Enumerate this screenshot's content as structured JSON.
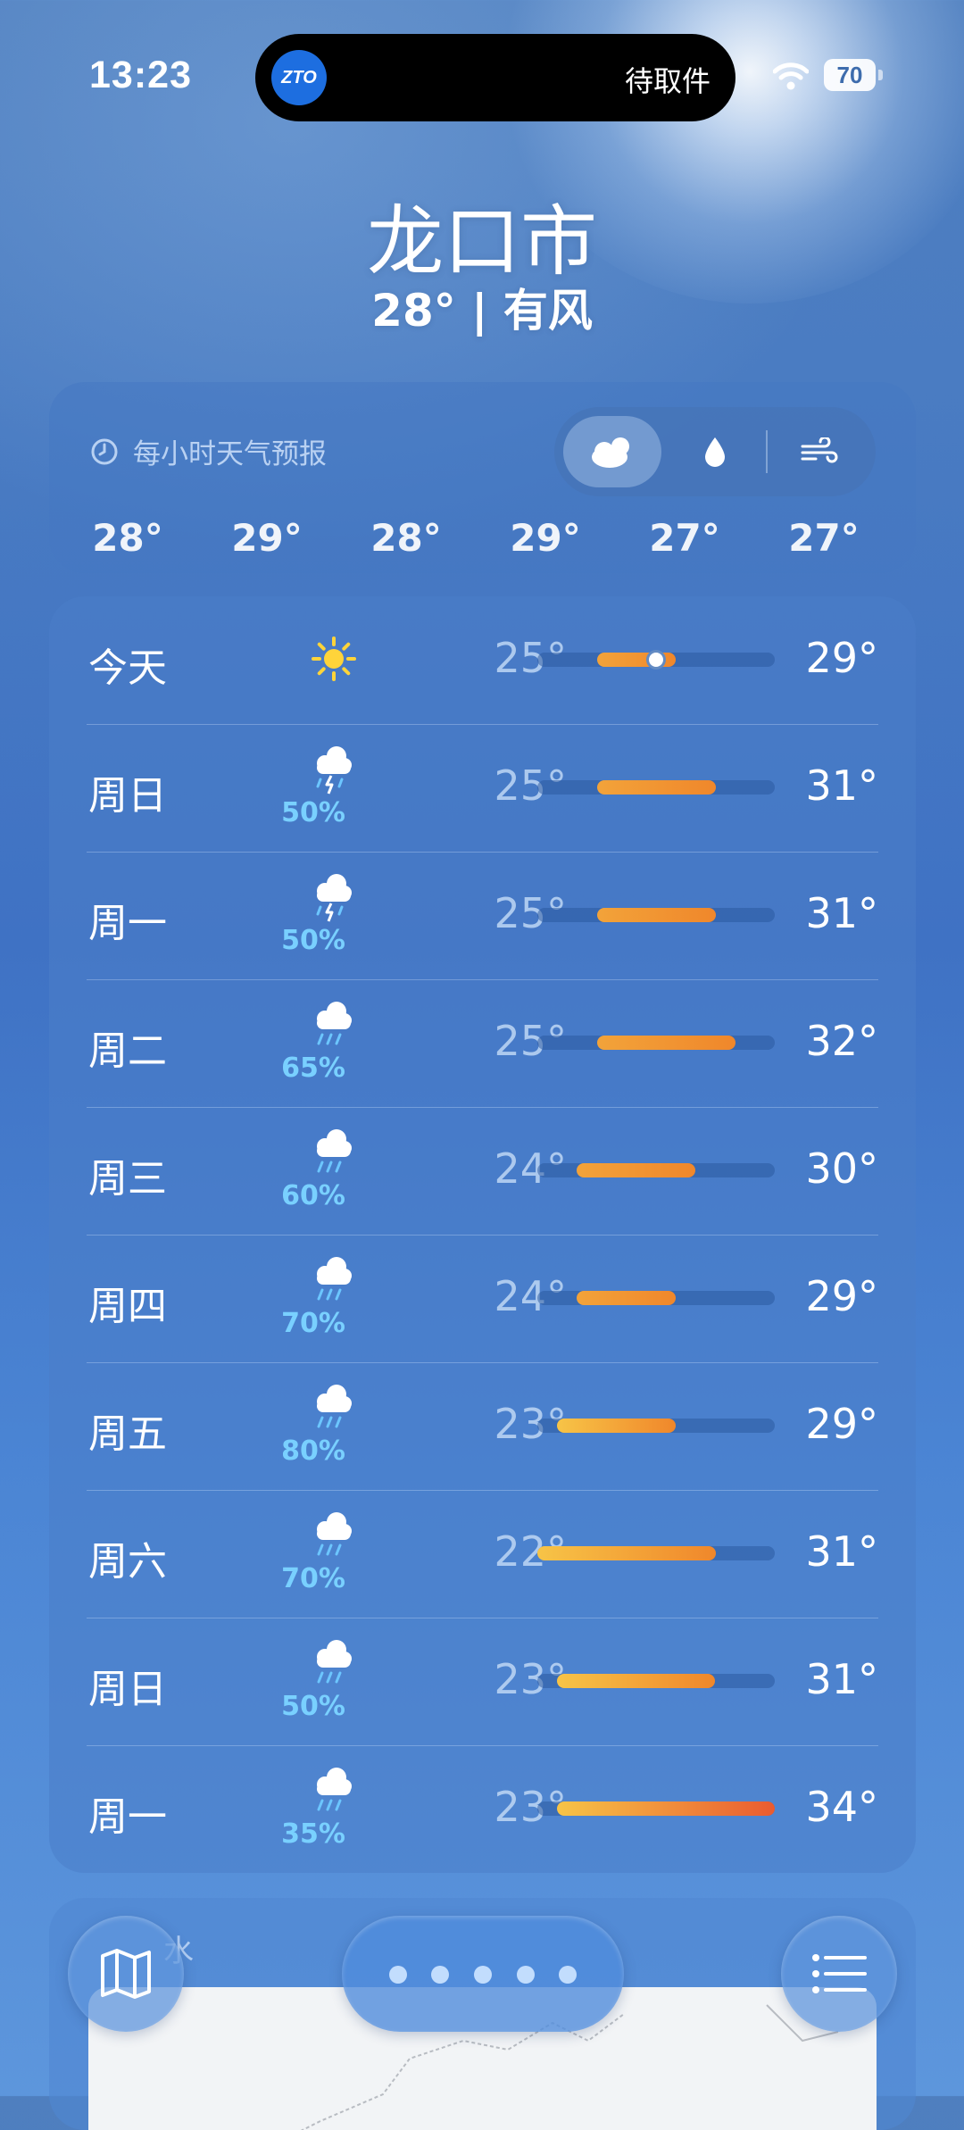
{
  "status_bar": {
    "time": "13:23",
    "island_text": "待取件",
    "island_logo_text": "ZTO",
    "battery": "70"
  },
  "header": {
    "city": "龙口市",
    "summary": "28° | 有风"
  },
  "hourly": {
    "title": "每小时天气预报",
    "temps": [
      "28°",
      "29°",
      "28°",
      "29°",
      "27°",
      "27°"
    ],
    "modes": [
      "cloud-icon",
      "droplet-icon",
      "wind-icon"
    ],
    "active_mode": "cloud-icon"
  },
  "daily": {
    "range_min": 22,
    "range_max": 34,
    "days": [
      {
        "day": "今天",
        "icon": "sun-icon",
        "precip": "",
        "low": "25°",
        "high": "29°",
        "lo": 25,
        "hi": 29,
        "current": 28
      },
      {
        "day": "周日",
        "icon": "thunderstorm-icon",
        "precip": "50%",
        "low": "25°",
        "high": "31°",
        "lo": 25,
        "hi": 31
      },
      {
        "day": "周一",
        "icon": "thunderstorm-icon",
        "precip": "50%",
        "low": "25°",
        "high": "31°",
        "lo": 25,
        "hi": 31
      },
      {
        "day": "周二",
        "icon": "rain-icon",
        "precip": "65%",
        "low": "25°",
        "high": "32°",
        "lo": 25,
        "hi": 32
      },
      {
        "day": "周三",
        "icon": "rain-icon",
        "precip": "60%",
        "low": "24°",
        "high": "30°",
        "lo": 24,
        "hi": 30
      },
      {
        "day": "周四",
        "icon": "rain-icon",
        "precip": "70%",
        "low": "24°",
        "high": "29°",
        "lo": 24,
        "hi": 29
      },
      {
        "day": "周五",
        "icon": "rain-icon",
        "precip": "80%",
        "low": "23°",
        "high": "29°",
        "lo": 23,
        "hi": 29
      },
      {
        "day": "周六",
        "icon": "rain-icon",
        "precip": "70%",
        "low": "22°",
        "high": "31°",
        "lo": 22,
        "hi": 31
      },
      {
        "day": "周日",
        "icon": "rain-icon",
        "precip": "50%",
        "low": "23°",
        "high": "31°",
        "lo": 23,
        "hi": 31
      },
      {
        "day": "周一",
        "icon": "rain-icon",
        "precip": "35%",
        "low": "23°",
        "high": "34°",
        "lo": 23,
        "hi": 34
      }
    ]
  },
  "map_card": {
    "label": "水"
  },
  "toolbar": {
    "page_count": 5,
    "active_page": 0,
    "left_icon": "map-icon",
    "right_icon": "list-icon"
  },
  "colors": {
    "bar_cool": "#f7c447",
    "bar_warm": "#f0872b",
    "bar_hot": "#ea5b30",
    "precip_text": "#79d0ff",
    "sun": "#ffd43a"
  }
}
